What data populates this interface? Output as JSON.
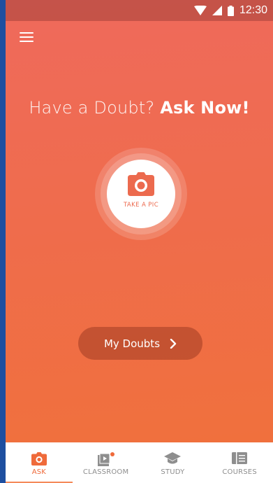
{
  "status_bar": {
    "time": "12:30"
  },
  "headline": {
    "prefix": "Have a Doubt?",
    "emphasis": "Ask Now!"
  },
  "camera_button": {
    "label": "TAKE A PIC"
  },
  "my_doubts_button": {
    "label": "My Doubts"
  },
  "bottom_nav": {
    "items": [
      {
        "label": "ASK",
        "icon": "camera-icon",
        "active": true
      },
      {
        "label": "CLASSROOM",
        "icon": "video-play-icon",
        "active": false,
        "badge": true
      },
      {
        "label": "STUDY",
        "icon": "graduation-cap-icon",
        "active": false
      },
      {
        "label": "COURSES",
        "icon": "book-icon",
        "active": false
      }
    ]
  },
  "colors": {
    "accent": "#ef6a3a",
    "gradient_top": "#ef6a5c",
    "gradient_bottom": "#f0713a"
  }
}
